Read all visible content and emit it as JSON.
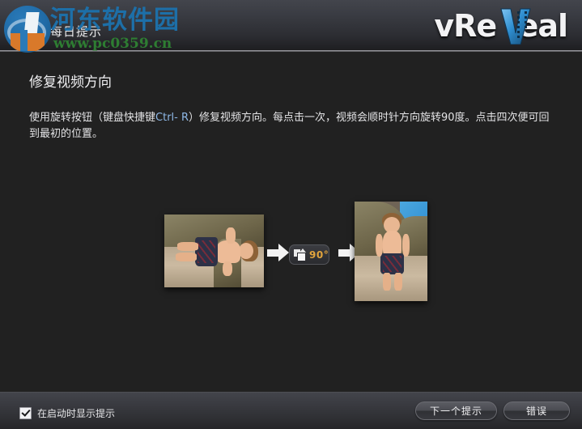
{
  "window": {
    "title": "每日提示",
    "background_color": "#212121"
  },
  "brand": {
    "logo_text_left": "vRe",
    "logo_text_right": "eal",
    "logo_mark_name": "film-strip-v-icon",
    "accent_color": "#2f8ed0"
  },
  "watermark": {
    "site_name": "河东软件园",
    "site_url": "www.pc0359.cn",
    "badge_name": "hedong-logo-icon",
    "text_color": "#1d6fa8",
    "url_color": "#2e7d32"
  },
  "tip": {
    "heading": "修复视频方向",
    "body_part_1": "使用旋转按钮（键盘快捷键",
    "body_shortcut": "Ctrl- R",
    "body_part_2": "）修复视频方向。每点击一次，视频会顺时针方向旋转90度。点击四次便可回到最初的位置。",
    "shortcut_color": "#8fb9e8"
  },
  "illustration": {
    "before_image_alt": "侧向视频缩略图",
    "after_image_alt": "已修正方向的视频缩略图",
    "arrow_left_name": "arrow-right-icon",
    "arrow_right_name": "arrow-right-icon",
    "rotate_button": {
      "icon_name": "rotate-90-icon",
      "label": "90°",
      "label_color": "#e2a43c"
    }
  },
  "footer": {
    "startup_checkbox": {
      "label": "在启动时显示提示",
      "checked": true
    },
    "next_tip_button": "下一个提示",
    "close_button": "错误"
  }
}
